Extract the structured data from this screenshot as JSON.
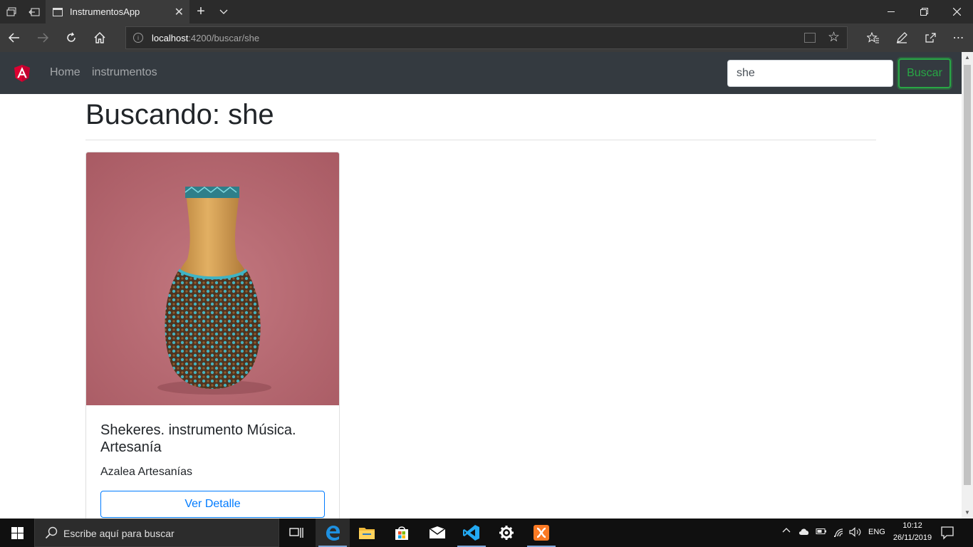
{
  "browser": {
    "tab_title": "InstrumentosApp",
    "url_host": "localhost",
    "url_path": ":4200/buscar/she"
  },
  "app_nav": {
    "links": [
      "Home",
      "instrumentos"
    ],
    "search_value": "she",
    "search_button": "Buscar"
  },
  "content": {
    "heading": "Buscando: she",
    "card": {
      "title": "Shekeres. instrumento Música. Artesanía",
      "text": "Azalea Artesanías",
      "button": "Ver Detalle"
    }
  },
  "taskbar": {
    "search_placeholder": "Escribe aquí para buscar",
    "language": "ENG",
    "time": "10:12",
    "date": "26/11/2019"
  },
  "colors": {
    "navbar_bg": "#343a40",
    "success": "#28a745",
    "primary": "#007bff"
  }
}
